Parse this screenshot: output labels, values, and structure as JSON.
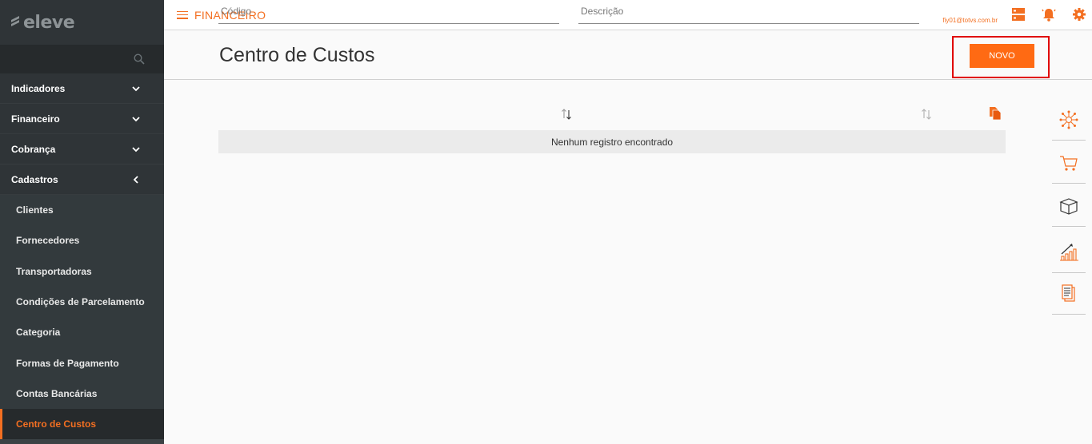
{
  "brand": {
    "name": "eleve"
  },
  "sidebar": {
    "search_placeholder": "",
    "items": [
      {
        "label": "Indicadores",
        "state": "collapsed"
      },
      {
        "label": "Financeiro",
        "state": "collapsed"
      },
      {
        "label": "Cobrança",
        "state": "collapsed"
      },
      {
        "label": "Cadastros",
        "state": "expanded"
      }
    ],
    "sub_items": [
      {
        "label": "Clientes"
      },
      {
        "label": "Fornecedores"
      },
      {
        "label": "Transportadoras"
      },
      {
        "label": "Condições de Parcelamento"
      },
      {
        "label": "Categoria"
      },
      {
        "label": "Formas de Pagamento"
      },
      {
        "label": "Contas Bancárias"
      },
      {
        "label": "Centro de Custos"
      }
    ],
    "active_sub_item": "Centro de Custos"
  },
  "topbar": {
    "module_title": "FINANCEIRO",
    "user_email": "fiy01@totvs.com.br",
    "icons": [
      "server-icon",
      "bell-icon",
      "gear-icon"
    ]
  },
  "page": {
    "title": "Centro de Custos",
    "new_button_label": "NOVO"
  },
  "table": {
    "columns": [
      {
        "label": "Código",
        "placeholder": "Código"
      },
      {
        "label": "Descrição",
        "placeholder": "Descrição"
      }
    ],
    "empty_message": "Nenhum registro encontrado"
  },
  "right_rail": {
    "icons": [
      "network-icon",
      "cart-icon",
      "box-icon",
      "growth-chart-icon",
      "documents-icon"
    ]
  },
  "colors": {
    "accent": "#f36f21",
    "button": "#ff6a13",
    "sidebar_bg": "#2f3437",
    "highlight": "#e00000"
  }
}
